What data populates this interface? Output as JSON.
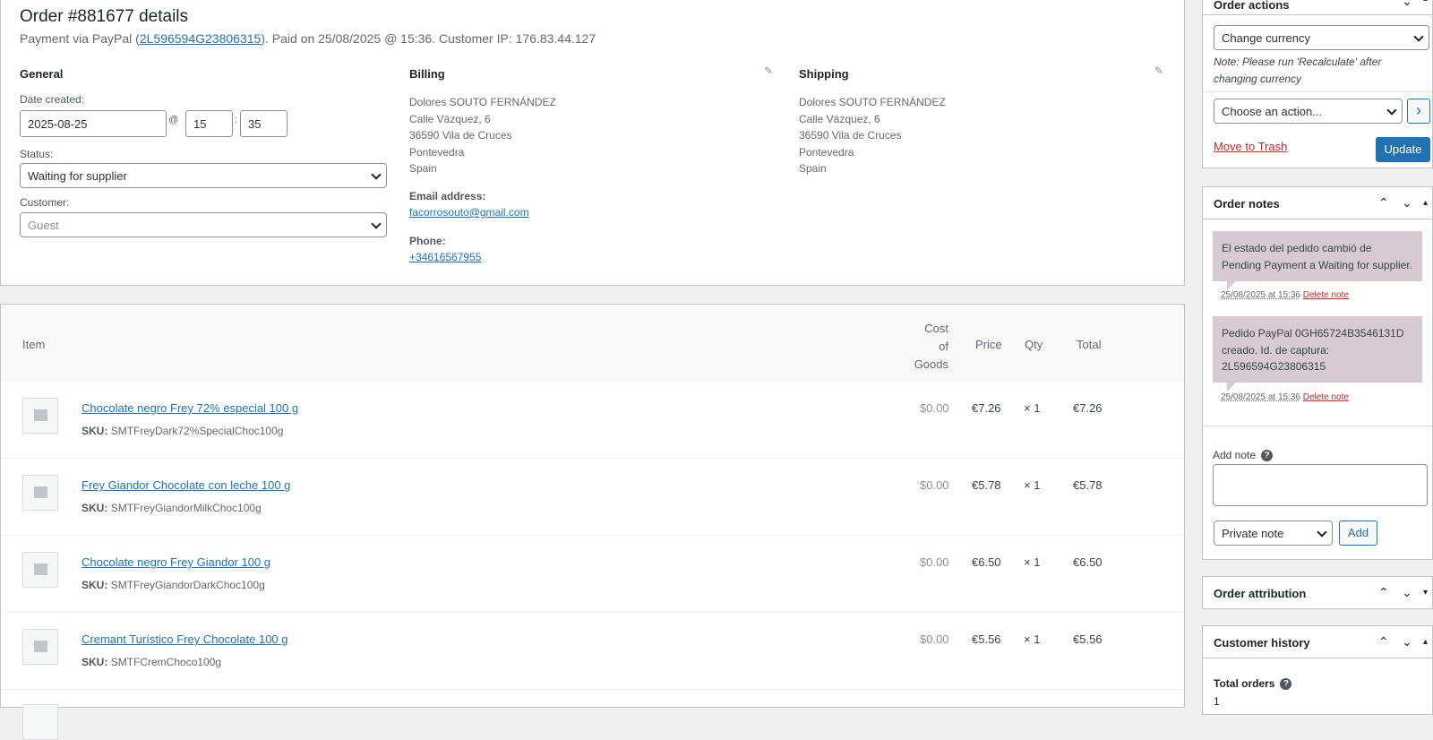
{
  "order": {
    "title": "Order #881677 details",
    "sub_pre": "Payment via PayPal (",
    "sub_link": "2L596594G23806315",
    "sub_post": "). Paid on 25/08/2025 @ 15:36. Customer IP: 176.83.44.127"
  },
  "general": {
    "heading": "General",
    "date_label": "Date created:",
    "date": "2025-08-25",
    "at": "@",
    "hour": "15",
    "colon": ":",
    "minute": "35",
    "status_label": "Status:",
    "status": "Waiting for supplier",
    "customer_label": "Customer:",
    "customer": "Guest"
  },
  "billing": {
    "heading": "Billing",
    "lines": [
      "Dolores SOUTO FERNÁNDEZ",
      "Calle Vázquez, 6",
      "36590 Vila de Cruces",
      "Pontevedra",
      "Spain"
    ],
    "email_label": "Email address:",
    "email": "facorrosouto@gmail.com",
    "phone_label": "Phone:",
    "phone": "+34616567955"
  },
  "shipping": {
    "heading": "Shipping",
    "lines": [
      "Dolores SOUTO FERNÁNDEZ",
      "Calle Vázquez, 6",
      "36590 Vila de Cruces",
      "Pontevedra",
      "Spain"
    ]
  },
  "items": {
    "headers": {
      "item": "Item",
      "cost": [
        "Cost",
        "of",
        "Goods"
      ],
      "price": "Price",
      "qty": "Qty",
      "total": "Total"
    },
    "rows": [
      {
        "name": "Chocolate negro Frey 72% especial 100 g",
        "sku_label": "SKU:",
        "sku": "SMTFreyDark72%SpecialChoc100g",
        "cost": "$0.00",
        "price": "€7.26",
        "qty": "× 1",
        "total": "€7.26"
      },
      {
        "name": "Frey Giandor Chocolate con leche 100 g",
        "sku_label": "SKU:",
        "sku": "SMTFreyGiandorMilkChoc100g",
        "cost": "$0.00",
        "price": "€5.78",
        "qty": "× 1",
        "total": "€5.78"
      },
      {
        "name": "Chocolate negro Frey Giandor 100 g",
        "sku_label": "SKU:",
        "sku": "SMTFreyGiandorDarkChoc100g",
        "cost": "$0.00",
        "price": "€6.50",
        "qty": "× 1",
        "total": "€6.50"
      },
      {
        "name": "Cremant Turístico Frey Chocolate 100 g",
        "sku_label": "SKU:",
        "sku": "SMTFCremChoco100g",
        "cost": "$0.00",
        "price": "€5.56",
        "qty": "× 1",
        "total": "€5.56"
      }
    ]
  },
  "order_actions": {
    "title": "Order actions",
    "currency_select": "Change currency",
    "note": "Note: Please run 'Recalculate' after changing currency",
    "action_select": "Choose an action...",
    "go": "›",
    "trash": "Move to Trash",
    "update": "Update"
  },
  "order_notes": {
    "title": "Order notes",
    "notes": [
      {
        "text": "El estado del pedido cambió de Pending Payment a Waiting for supplier.",
        "date": "25/08/2025 at 15:36",
        "delete": "Delete note"
      },
      {
        "text": "Pedido PayPal 0GH65724B3546131D creado. Id. de captura: 2L596594G23806315",
        "date": "25/08/2025 at 15:36",
        "delete": "Delete note"
      }
    ],
    "add_label": "Add note",
    "help": "?",
    "type": "Private note",
    "add_button": "Add"
  },
  "order_attribution": {
    "title": "Order attribution"
  },
  "customer_history": {
    "title": "Customer history",
    "total_orders_label": "Total orders",
    "help": "?",
    "total_orders": "1"
  },
  "toggles": {
    "up": "⌃",
    "down": "⌄",
    "collapse": "▴",
    "expand": "▾"
  }
}
